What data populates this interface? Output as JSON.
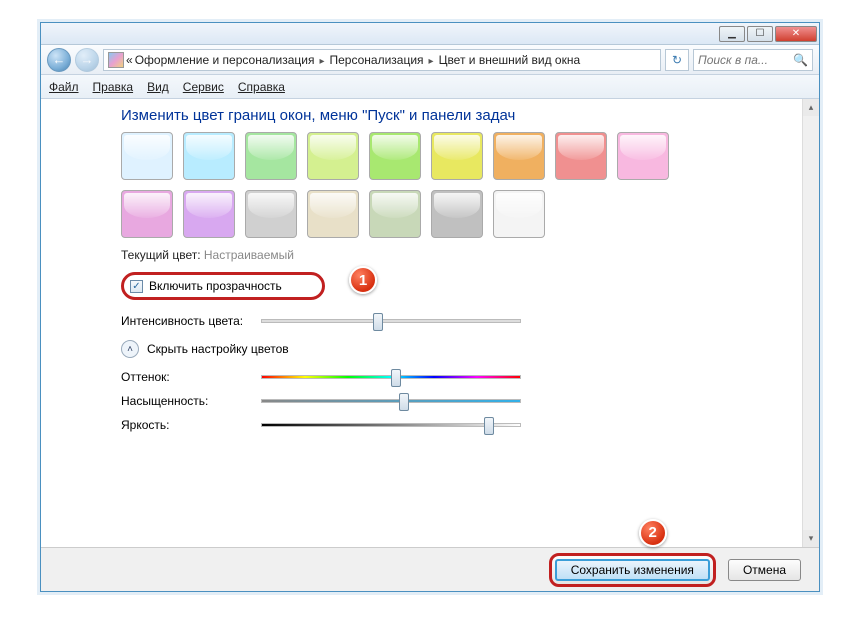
{
  "titlebar": {
    "min": "▁",
    "max": "☐",
    "close": "✕"
  },
  "breadcrumb": {
    "prefix": "«",
    "items": [
      "Оформление и персонализация",
      "Персонализация",
      "Цвет и внешний вид окна"
    ]
  },
  "search": {
    "placeholder": "Поиск в па...",
    "icon": "🔍"
  },
  "refresh_icon": "↻",
  "nav": {
    "back": "←",
    "forward": "→"
  },
  "menu": {
    "file": "Файл",
    "edit": "Правка",
    "view": "Вид",
    "tools": "Сервис",
    "help": "Справка"
  },
  "heading": "Изменить цвет границ окон, меню \"Пуск\" и панели задач",
  "swatch_colors": [
    "#dff2ff",
    "#b8ecff",
    "#a5e6a0",
    "#d4f090",
    "#a8e870",
    "#e8e860",
    "#f0b060",
    "#f09090",
    "#f8b8e0",
    "#e8a8e0",
    "#d8a8f0",
    "#d0d0d0",
    "#e8e0c8",
    "#c8d8b8",
    "#c0c0c0",
    "#f4f4f4"
  ],
  "current_color": {
    "label": "Текущий цвет:",
    "value": "Настраиваемый"
  },
  "transparency": {
    "label": "Включить прозрачность",
    "checked": true
  },
  "intensity": {
    "label": "Интенсивность цвета:",
    "value": 45
  },
  "collapse": {
    "label": "Скрыть настройку цветов",
    "icon": "˄"
  },
  "hue": {
    "label": "Оттенок:",
    "value": 52
  },
  "sat": {
    "label": "Насыщенность:",
    "value": 55
  },
  "bri": {
    "label": "Яркость:",
    "value": 88
  },
  "badges": {
    "one": "1",
    "two": "2"
  },
  "footer": {
    "save": "Сохранить изменения",
    "cancel": "Отмена"
  }
}
